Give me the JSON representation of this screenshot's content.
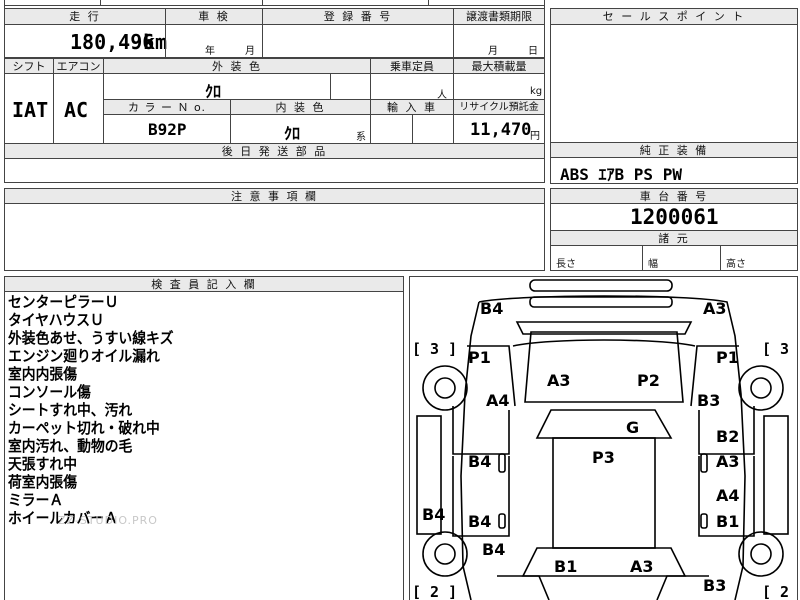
{
  "top": {
    "mileage_header": "走 行",
    "mileage_value": "180,496",
    "mileage_unit": "km",
    "inspection_header": "車 検",
    "inspection_year": "年",
    "inspection_month": "月",
    "registration_header": "登 録 番 号",
    "transfer_header": "譲渡書類期限",
    "transfer_month": "月",
    "transfer_day": "日",
    "shift_header": "シフト",
    "shift_value": "IAT",
    "aircon_header": "エアコン",
    "aircon_value": "AC",
    "exterior_header": "外 装 色",
    "exterior_value": "ｸﾛ",
    "capacity_header": "乗車定員",
    "capacity_unit": "人",
    "max_load_header": "最大積載量",
    "max_load_unit": "kg",
    "color_no_header": "カ ラ ー Ｎ o.",
    "color_no_value": "B92P",
    "interior_header": "内 装 色",
    "interior_value": "ｸﾛ",
    "interior_suffix": "系",
    "import_header": "輸 入 車",
    "recycle_header": "リサイクル預託金",
    "recycle_value": "11,470",
    "recycle_unit": "円",
    "later_parts_header": "後 日 発 送 部 品"
  },
  "sales_point_header": "セ ー ル ス ポ イ ン ト",
  "equipment": {
    "header": "純 正 装 備",
    "value": "ABS ｴｱB PS PW"
  },
  "notes_header": "注 意 事 項 欄",
  "chassis": {
    "header": "車 台 番 号",
    "value": "1200061",
    "dims_header": "諸 元",
    "length_label": "長さ",
    "width_label": "幅",
    "height_label": "高さ"
  },
  "inspector": {
    "header": "検 査 員 記 入 欄",
    "lines": [
      "センターピラーＵ",
      "タイヤハウスＵ",
      "外装色あせ、うすい線キズ",
      "エンジン廻りオイル漏れ",
      "室内内張傷",
      "コンソール傷",
      "シートすれ中、汚れ",
      "カーペット切れ・破れ中",
      "室内汚れ、動物の毛",
      "天張すれ中",
      "荷室内張傷",
      "ミラーＡ",
      "ホイールカバーＡ"
    ],
    "watermark": "ZZ-STUDIO.PRO"
  },
  "diagram": {
    "bracket_left_top": "[ 3 ]",
    "bracket_right_top": "[ 3",
    "bracket_left_bottom": "[ 2 ]",
    "bracket_right_bottom": "[ 2",
    "codes": {
      "b4_top_left": "B4",
      "a3_top_right": "A3",
      "p1_left": "P1",
      "p1_right": "P1",
      "a3_center": "A3",
      "p2_center": "P2",
      "a4_left": "A4",
      "b3_right": "B3",
      "g_center": "G",
      "b2_right": "B2",
      "p3_center": "P3",
      "b4_left_mid": "B4",
      "a3_right_mid": "A3",
      "a4_right_low": "A4",
      "b4_far_left": "B4",
      "b4_left_low": "B4",
      "b1_right": "B1",
      "b4_left_bottom": "B4",
      "b1_bottom": "B1",
      "a3_bottom": "A3",
      "b3_bottom_right": "B3"
    }
  }
}
